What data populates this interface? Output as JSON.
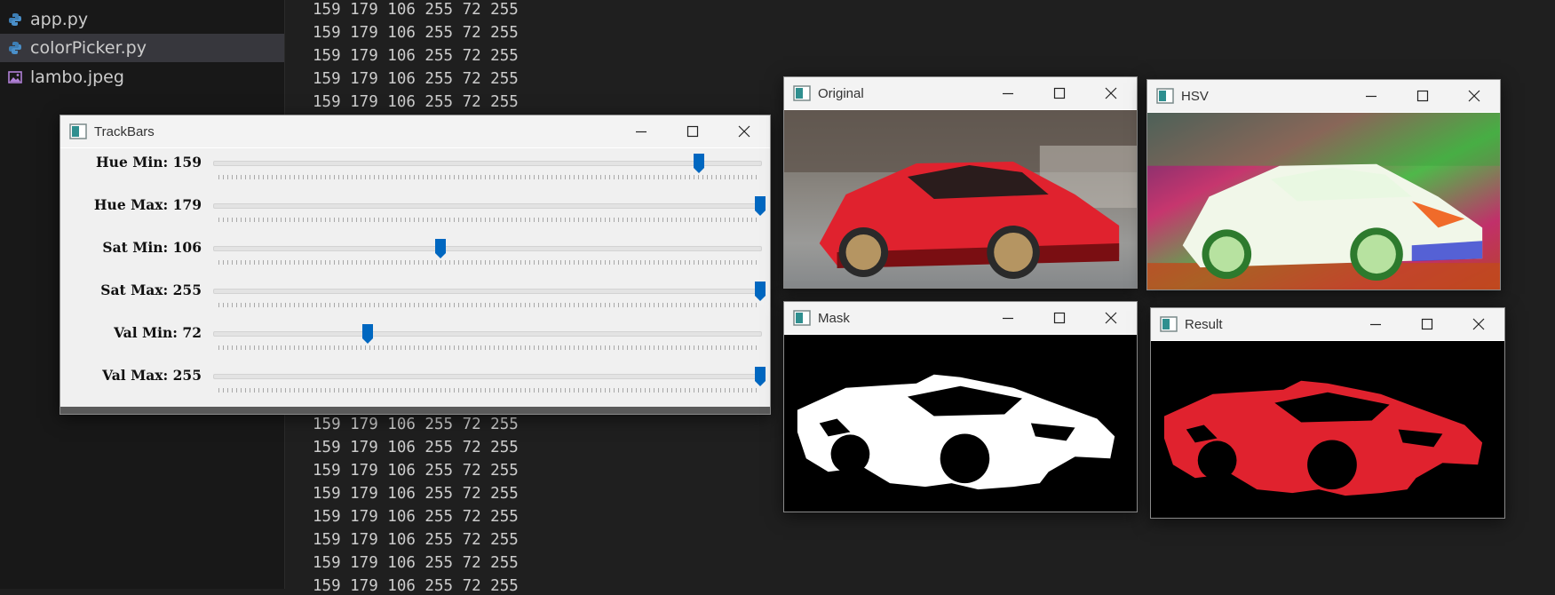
{
  "explorer": {
    "files": [
      {
        "name": "app.py",
        "icon": "python-icon"
      },
      {
        "name": "colorPicker.py",
        "icon": "python-icon",
        "selected": true
      },
      {
        "name": "lambo.jpeg",
        "icon": "image-file-icon"
      }
    ]
  },
  "terminal": {
    "line": "159 179 106 255 72 255"
  },
  "windows": {
    "trackbars": {
      "title": "TrackBars",
      "bars": [
        {
          "label": "Hue Min: 159",
          "value": 159,
          "max": 179
        },
        {
          "label": "Hue Max: 179",
          "value": 179,
          "max": 179
        },
        {
          "label": "Sat Min: 106",
          "value": 106,
          "max": 255
        },
        {
          "label": "Sat Max: 255",
          "value": 255,
          "max": 255
        },
        {
          "label": "Val Min: 72",
          "value": 72,
          "max": 255
        },
        {
          "label": "Val Max: 255",
          "value": 255,
          "max": 255
        }
      ]
    },
    "original": {
      "title": "Original"
    },
    "hsv": {
      "title": "HSV"
    },
    "mask": {
      "title": "Mask"
    },
    "result": {
      "title": "Result"
    }
  },
  "colors": {
    "thumb": "#0067c0",
    "car_red": "#e0222e",
    "python_blue": "#3d7eb5",
    "image_purple": "#b180d7"
  }
}
